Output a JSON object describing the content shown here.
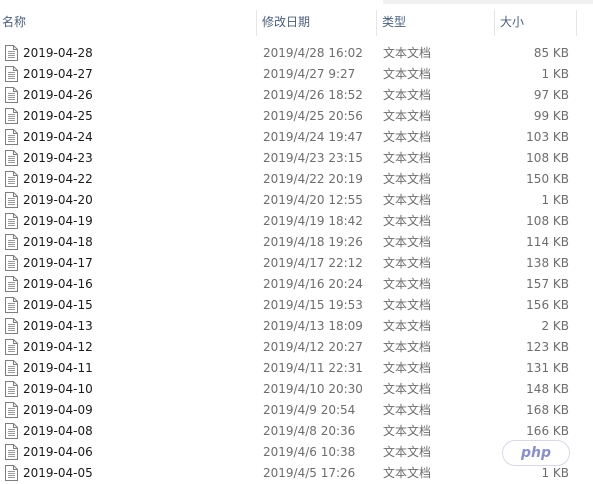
{
  "columns": {
    "name": "名称",
    "date": "修改日期",
    "type": "类型",
    "size": "大小"
  },
  "files": [
    {
      "name": "2019-04-28",
      "date": "2019/4/28 16:02",
      "type": "文本文档",
      "size": "85 KB"
    },
    {
      "name": "2019-04-27",
      "date": "2019/4/27 9:27",
      "type": "文本文档",
      "size": "1 KB"
    },
    {
      "name": "2019-04-26",
      "date": "2019/4/26 18:52",
      "type": "文本文档",
      "size": "97 KB"
    },
    {
      "name": "2019-04-25",
      "date": "2019/4/25 20:56",
      "type": "文本文档",
      "size": "99 KB"
    },
    {
      "name": "2019-04-24",
      "date": "2019/4/24 19:47",
      "type": "文本文档",
      "size": "103 KB"
    },
    {
      "name": "2019-04-23",
      "date": "2019/4/23 23:15",
      "type": "文本文档",
      "size": "108 KB"
    },
    {
      "name": "2019-04-22",
      "date": "2019/4/22 20:19",
      "type": "文本文档",
      "size": "150 KB"
    },
    {
      "name": "2019-04-20",
      "date": "2019/4/20 12:55",
      "type": "文本文档",
      "size": "1 KB"
    },
    {
      "name": "2019-04-19",
      "date": "2019/4/19 18:42",
      "type": "文本文档",
      "size": "108 KB"
    },
    {
      "name": "2019-04-18",
      "date": "2019/4/18 19:26",
      "type": "文本文档",
      "size": "114 KB"
    },
    {
      "name": "2019-04-17",
      "date": "2019/4/17 22:12",
      "type": "文本文档",
      "size": "138 KB"
    },
    {
      "name": "2019-04-16",
      "date": "2019/4/16 20:24",
      "type": "文本文档",
      "size": "157 KB"
    },
    {
      "name": "2019-04-15",
      "date": "2019/4/15 19:53",
      "type": "文本文档",
      "size": "156 KB"
    },
    {
      "name": "2019-04-13",
      "date": "2019/4/13 18:09",
      "type": "文本文档",
      "size": "2 KB"
    },
    {
      "name": "2019-04-12",
      "date": "2019/4/12 20:27",
      "type": "文本文档",
      "size": "123 KB"
    },
    {
      "name": "2019-04-11",
      "date": "2019/4/11 22:31",
      "type": "文本文档",
      "size": "131 KB"
    },
    {
      "name": "2019-04-10",
      "date": "2019/4/10 20:30",
      "type": "文本文档",
      "size": "148 KB"
    },
    {
      "name": "2019-04-09",
      "date": "2019/4/9 20:54",
      "type": "文本文档",
      "size": "168 KB"
    },
    {
      "name": "2019-04-08",
      "date": "2019/4/8 20:36",
      "type": "文本文档",
      "size": "166 KB"
    },
    {
      "name": "2019-04-06",
      "date": "2019/4/6 10:38",
      "type": "文本文档",
      "size": ""
    },
    {
      "name": "2019-04-05",
      "date": "2019/4/5 17:26",
      "type": "文本文档",
      "size": "1 KB"
    }
  ],
  "icons": {
    "file": "text-document-icon",
    "sort": "sort-up-icon"
  },
  "watermark": "php",
  "colors": {
    "header_text": "#4c607a",
    "detail_text": "#6d6d6d",
    "name_text": "#1a1a1a"
  }
}
